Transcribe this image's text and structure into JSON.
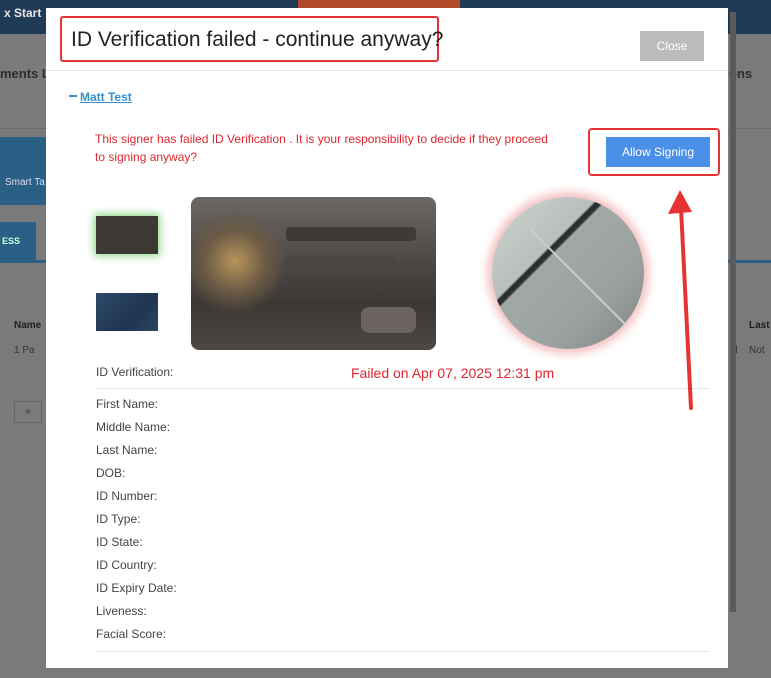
{
  "background": {
    "topbar_text": "x Start",
    "title_left": "ments Le",
    "title_right": "ons",
    "smart_label": "Smart Ta",
    "tab_label": "ESS",
    "col_name": "Name",
    "col_last": "Last",
    "row_text": "1 Pa",
    "row_d": "d",
    "row_not": "Not",
    "pager_prev": "«"
  },
  "modal": {
    "title": "ID Verification failed - continue anyway?",
    "close_label": "Close",
    "signer_name": "Matt Test",
    "warning": "This signer has failed ID Verification . It is your responsibility to decide if they proceed to signing anyway?",
    "allow_label": "Allow Signing",
    "verification_label": "ID Verification:",
    "verification_value": "Failed on Apr 07, 2025 12:31 pm",
    "fields": [
      "First Name:",
      "Middle Name:",
      "Last Name:",
      "DOB:",
      "ID Number:",
      "ID Type:",
      "ID State:",
      "ID Country:",
      "ID Expiry Date:",
      "Liveness:",
      "Facial Score:"
    ]
  },
  "colors": {
    "accent_blue": "#4a8fe8",
    "alert_red": "#e0262e",
    "annotation_red": "#e53333"
  }
}
